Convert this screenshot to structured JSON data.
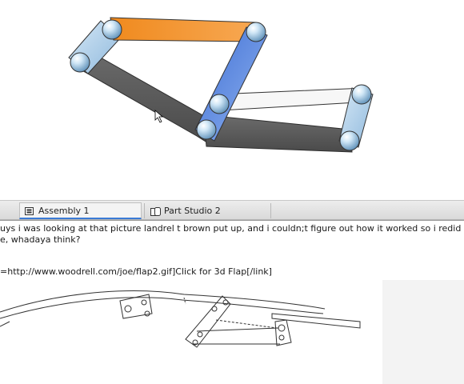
{
  "tabs": [
    {
      "label": "Assembly 1",
      "icon": "assembly-icon",
      "active": true
    },
    {
      "label": "Part Studio 2",
      "icon": "part-studio-icon",
      "active": false
    }
  ],
  "post": {
    "line1": "uys i was looking at that picture landrel t brown put up, and i couldn;t figure out how it worked so i redid it s",
    "line2": "e, whadaya think?",
    "link_line": "=http://www.woodrell.com/joe/flap2.gif]Click for 3d Flap[/link]"
  },
  "colors": {
    "link_orange": "#f08a1e",
    "link_blue": "#4a78d8",
    "link_lightblue": "#a9cbe6",
    "link_gray": "#555555",
    "link_white": "#f7f7f7",
    "accent": "#3b7bd6"
  }
}
